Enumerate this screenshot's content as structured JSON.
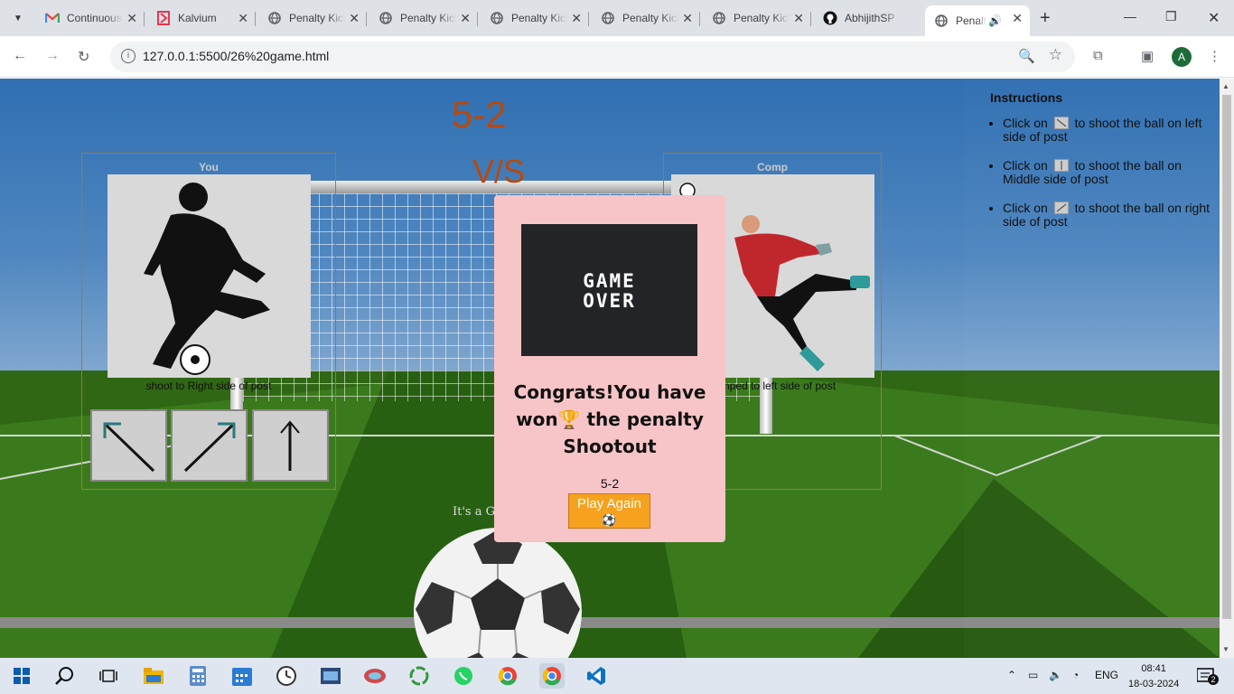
{
  "browser": {
    "tabs": [
      {
        "title": "Continuous",
        "favicon": "gmail-icon"
      },
      {
        "title": "Kalvium",
        "favicon": "kalvium-icon"
      },
      {
        "title": "Penalty Kick",
        "favicon": "globe-icon"
      },
      {
        "title": "Penalty Kick",
        "favicon": "globe-icon"
      },
      {
        "title": "Penalty Kick",
        "favicon": "globe-icon"
      },
      {
        "title": "Penalty Kick",
        "favicon": "globe-icon"
      },
      {
        "title": "Penalty Kick",
        "favicon": "globe-icon"
      },
      {
        "title": "AbhijithSP",
        "favicon": "github-icon"
      },
      {
        "title": "Penalty",
        "favicon": "globe-icon",
        "active": true
      }
    ],
    "url": "127.0.0.1:5500/26%20game.html",
    "profile_initial": "A"
  },
  "game": {
    "score_top": "5-2",
    "vs": "V/S",
    "player": {
      "title": "You",
      "caption": "shoot to Right side of post"
    },
    "computer": {
      "title": "Comp",
      "caption": "Jumped to left side of post"
    },
    "goal_text": "It's a Goal!"
  },
  "instructions": {
    "heading": "Instructions",
    "items": [
      {
        "pre": "Click on",
        "post": "to shoot the ball on left side of post"
      },
      {
        "pre": "Click on",
        "post": "to shoot the ball on Middle side of post"
      },
      {
        "pre": "Click on",
        "post": "to shoot the ball on right side of post"
      }
    ]
  },
  "modal": {
    "banner_line1": "GAME",
    "banner_line2": "OVER",
    "message_part1": "Congrats!You have won",
    "trophy": "🏆",
    "message_part2": " the penalty Shootout",
    "score": "5-2",
    "play_again": "Play Again",
    "play_again_icon": "⚽"
  },
  "taskbar": {
    "lang": "ENG",
    "time": "08:41",
    "date": "18-03-2024",
    "notifications": "2"
  }
}
